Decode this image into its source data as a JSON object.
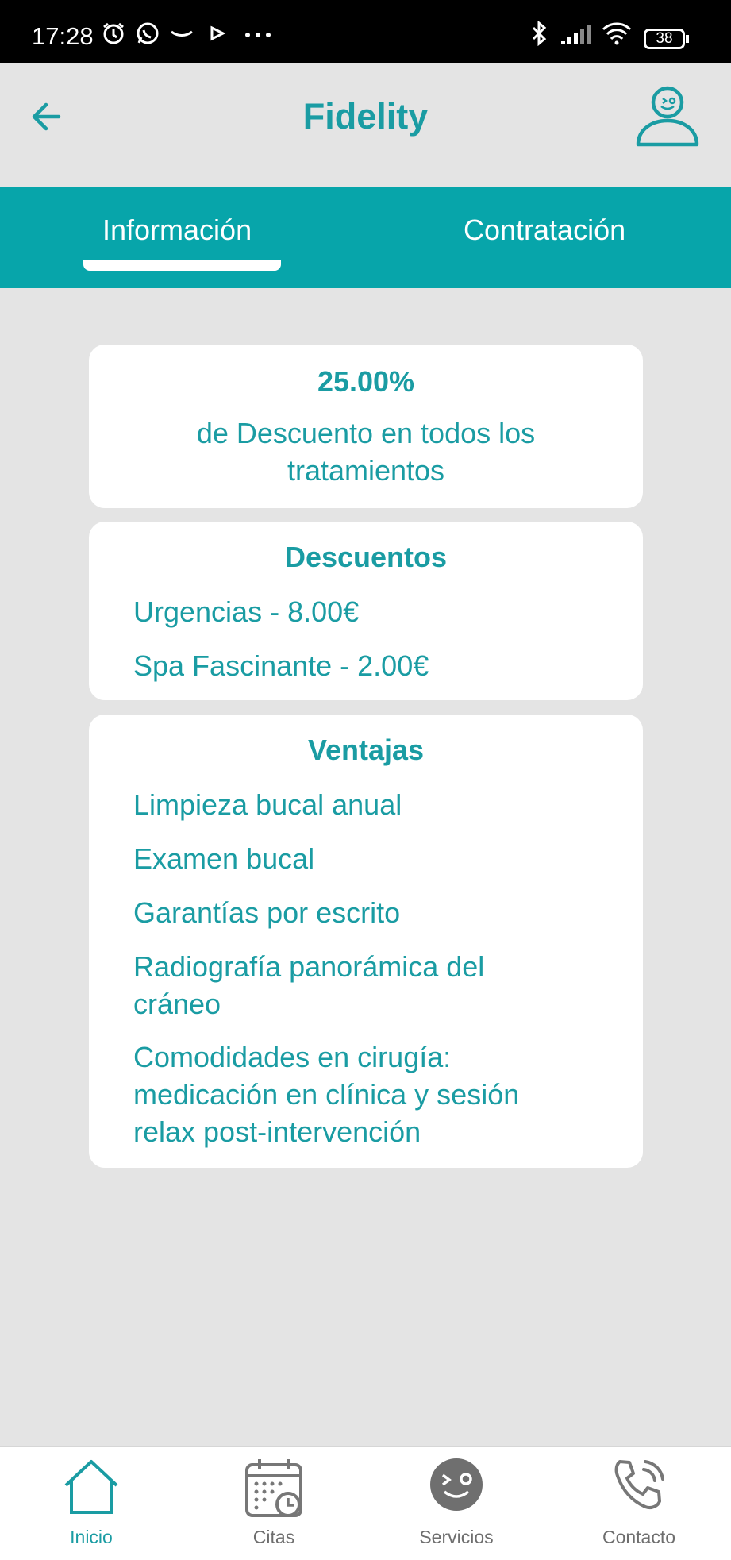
{
  "status_bar": {
    "time": "17:28",
    "battery": "38"
  },
  "header": {
    "title": "Fidelity"
  },
  "tabs": [
    {
      "label": "Información",
      "active": true
    },
    {
      "label": "Contratación",
      "active": false
    }
  ],
  "discount_card": {
    "percent": "25.00%",
    "line1": "de Descuento en todos los",
    "line2": "tratamientos"
  },
  "descuentos_card": {
    "title": "Descuentos",
    "items": [
      "Urgencias - 8.00€",
      "Spa Fascinante - 2.00€"
    ]
  },
  "ventajas_card": {
    "title": "Ventajas",
    "items": [
      "Limpieza bucal anual",
      "Examen bucal",
      "Garantías por escrito",
      "Radiografía panorámica del cráneo",
      "Comodidades en cirugía: medicación en clínica y sesión relax post-intervención"
    ]
  },
  "bottom_nav": [
    {
      "label": "Inicio",
      "icon": "home-icon",
      "active": true
    },
    {
      "label": "Citas",
      "icon": "calendar-icon",
      "active": false
    },
    {
      "label": "Servicios",
      "icon": "smiley-icon",
      "active": false
    },
    {
      "label": "Contacto",
      "icon": "phone-icon",
      "active": false
    }
  ],
  "colors": {
    "accent": "#1a9ca3",
    "tab_bar": "#07a5aa",
    "background": "#e4e4e4"
  }
}
